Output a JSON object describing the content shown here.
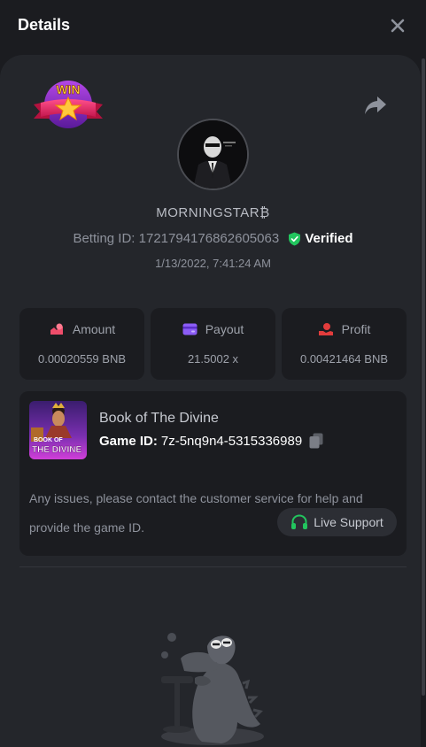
{
  "header": {
    "title": "Details"
  },
  "badge": {
    "text": "WIN"
  },
  "user": {
    "name": "MORNINGSTAR₿",
    "betting_id_label": "Betting ID:",
    "betting_id": "1721794176862605063",
    "verified_label": "Verified",
    "datetime": "1/13/2022, 7:41:24 AM"
  },
  "stats": [
    {
      "label": "Amount",
      "value": "0.00020559 BNB",
      "icon": "coins-icon"
    },
    {
      "label": "Payout",
      "value": "21.5002 x",
      "icon": "wallet-icon"
    },
    {
      "label": "Profit",
      "value": "0.00421464 BNB",
      "icon": "hand-coin-icon"
    }
  ],
  "game": {
    "name": "Book of The Divine",
    "id_label": "Game ID:",
    "id": "7z-5nq9n4-5315336989",
    "thumb_line1": "BOOK OF",
    "thumb_line2": "THE DIVINE"
  },
  "support": {
    "message": "Any issues, please contact the customer service for help and provide the game ID.",
    "button_label": "Live Support"
  },
  "colors": {
    "background": "#1b1c20",
    "panel": "#24262b",
    "verified_green": "#22c55e",
    "amount_icon": "#ef4d6b",
    "payout_icon": "#8b5cf6",
    "profit_icon": "#e23c3c",
    "support_icon": "#22c55e"
  }
}
